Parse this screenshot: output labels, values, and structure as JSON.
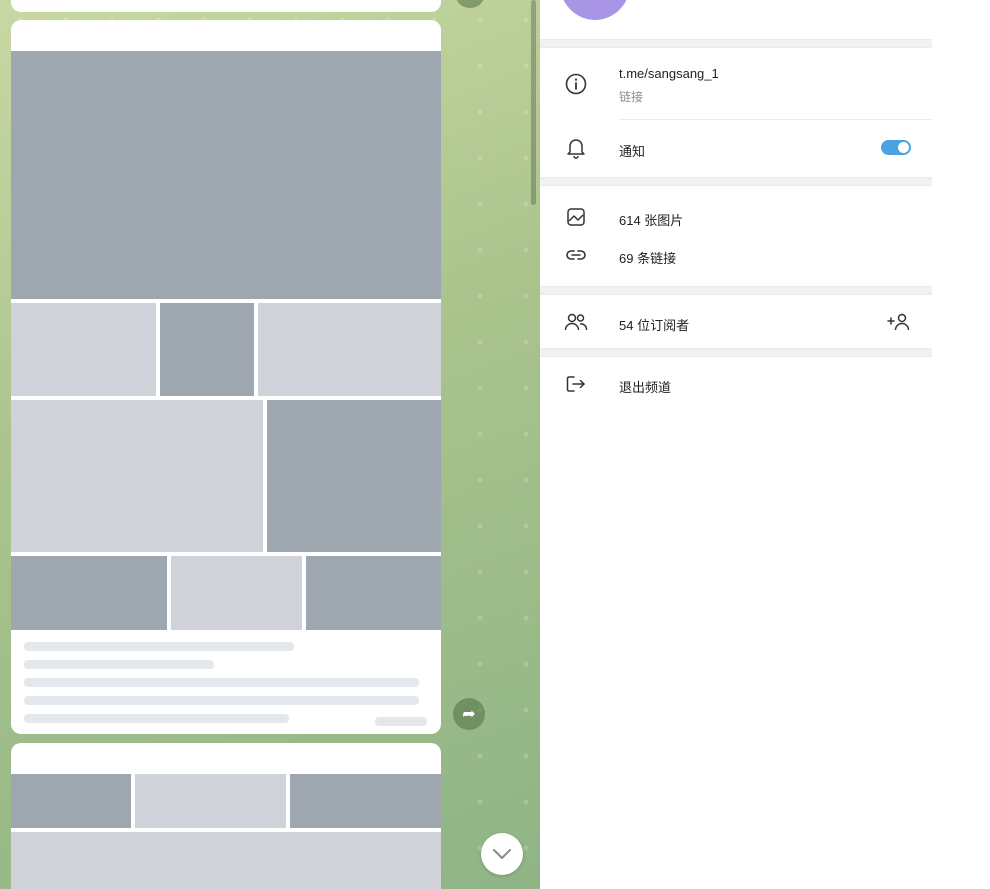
{
  "chat": {
    "note": ""
  },
  "info": {
    "link": "t.me/sangsang_1",
    "link_caption": "链接",
    "notifications_label": "通知",
    "notifications_on": true,
    "photos_label": "614 张图片",
    "links_label": "69 条链接",
    "subscribers_label": "54 位订阅者",
    "leave_label": "退出频道"
  },
  "colors": {
    "accent": "#2b8fd0",
    "toggle": "#4aa3df",
    "avatar": "#a995e6"
  }
}
